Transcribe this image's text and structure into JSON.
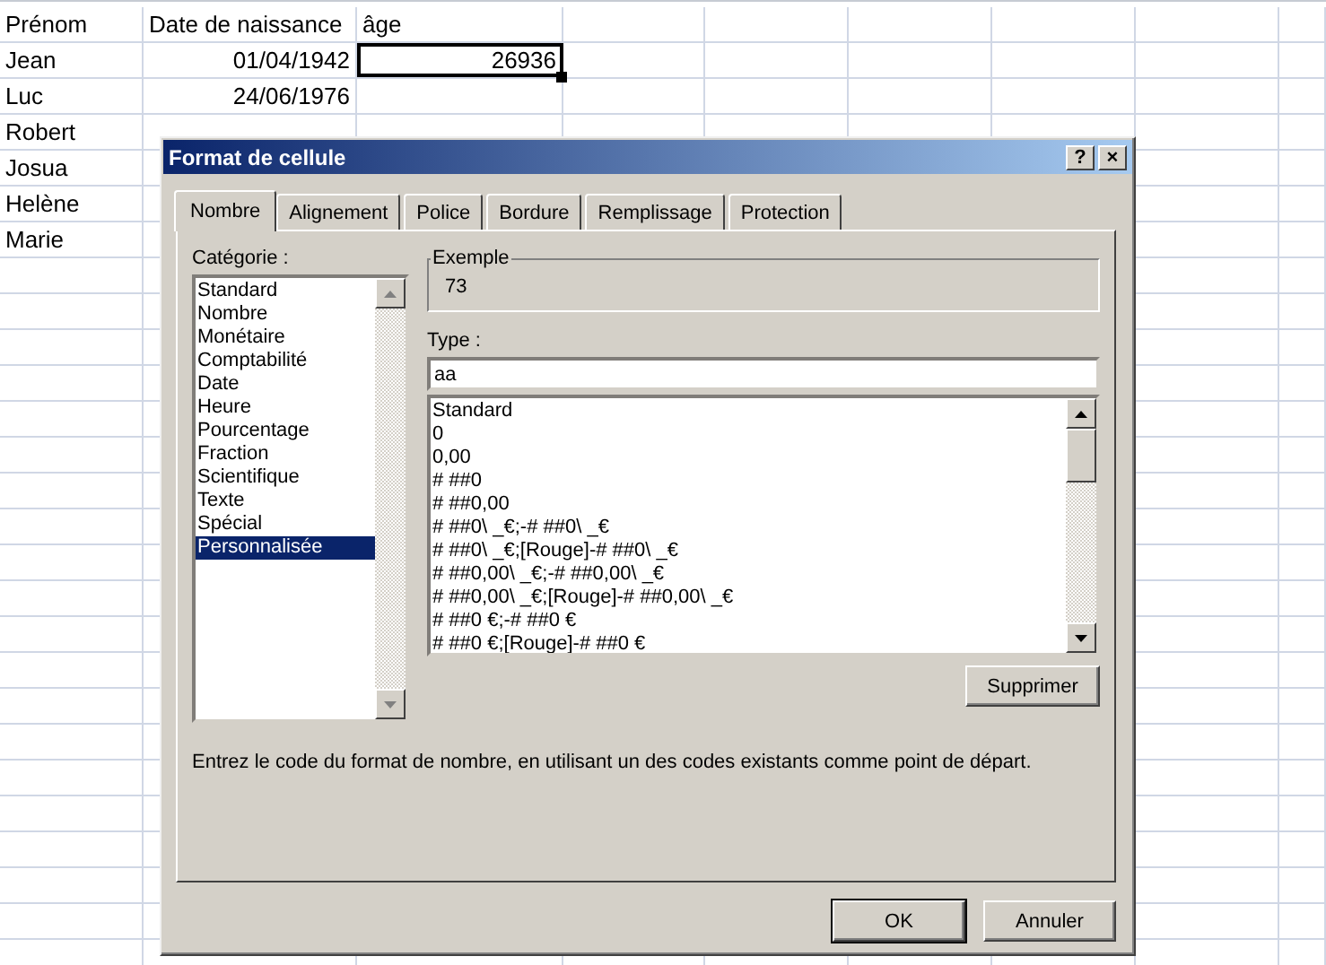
{
  "sheet": {
    "rows": [
      [
        {
          "text": "Prénom",
          "selected": false
        },
        {
          "text": "Date de naissance",
          "selected": false
        },
        {
          "text": "âge",
          "selected": false
        }
      ],
      [
        {
          "text": "Jean",
          "selected": false
        },
        {
          "text": "01/04/1942",
          "selected": false
        },
        {
          "text": "26936",
          "selected": true
        }
      ],
      [
        {
          "text": "Luc",
          "selected": false
        },
        {
          "text": "24/06/1976",
          "selected": false
        }
      ],
      [
        {
          "text": "Robert",
          "selected": false
        }
      ],
      [
        {
          "text": "Josua",
          "selected": false
        }
      ],
      [
        {
          "text": "Helène",
          "selected": false
        }
      ],
      [
        {
          "text": "Marie",
          "selected": false
        }
      ]
    ]
  },
  "dialog": {
    "title": "Format de cellule",
    "help_button": "?",
    "close_button": "×",
    "tabs": [
      {
        "label": "Nombre",
        "selected": true
      },
      {
        "label": "Alignement",
        "selected": false
      },
      {
        "label": "Police",
        "selected": false
      },
      {
        "label": "Bordure",
        "selected": false
      },
      {
        "label": "Remplissage",
        "selected": false
      },
      {
        "label": "Protection",
        "selected": false
      }
    ],
    "category_label": "Catégorie :",
    "categories": [
      {
        "label": "Standard",
        "selected": false
      },
      {
        "label": "Nombre",
        "selected": false
      },
      {
        "label": "Monétaire",
        "selected": false
      },
      {
        "label": "Comptabilité",
        "selected": false
      },
      {
        "label": "Date",
        "selected": false
      },
      {
        "label": "Heure",
        "selected": false
      },
      {
        "label": "Pourcentage",
        "selected": false
      },
      {
        "label": "Fraction",
        "selected": false
      },
      {
        "label": "Scientifique",
        "selected": false
      },
      {
        "label": "Texte",
        "selected": false
      },
      {
        "label": "Spécial",
        "selected": false
      },
      {
        "label": "Personnalisée",
        "selected": true
      }
    ],
    "example": {
      "legend": "Exemple",
      "value": "73"
    },
    "type_label": "Type :",
    "type_value": "aa",
    "formats": [
      "Standard",
      "0",
      "0,00",
      "# ##0",
      "# ##0,00",
      "# ##0\\ _€;-# ##0\\ _€",
      "# ##0\\ _€;[Rouge]-# ##0\\ _€",
      "# ##0,00\\ _€;-# ##0,00\\ _€",
      "# ##0,00\\ _€;[Rouge]-# ##0,00\\ _€",
      "# ##0 €;-# ##0 €",
      "# ##0 €;[Rouge]-# ##0 €"
    ],
    "delete_button": "Supprimer",
    "description": "Entrez le code du format de nombre, en utilisant un des codes existants comme point de départ.",
    "ok_button": "OK",
    "cancel_button": "Annuler"
  }
}
